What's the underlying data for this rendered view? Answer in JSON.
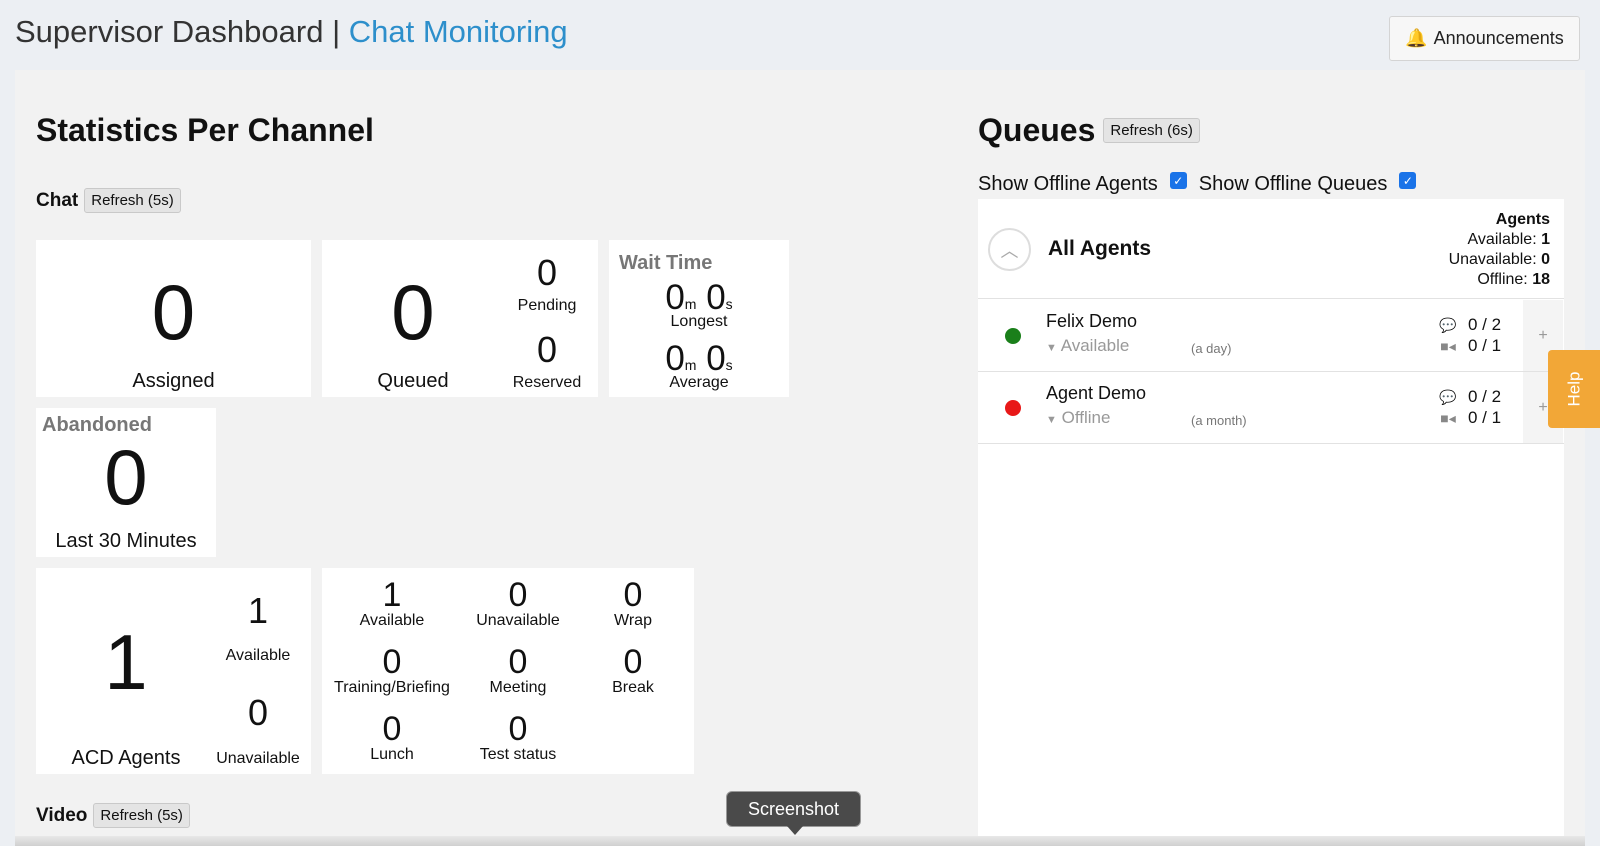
{
  "header": {
    "title": "Supervisor Dashboard",
    "separator": "|",
    "link": "Chat Monitoring",
    "announcements_label": "Announcements"
  },
  "stats": {
    "title": "Statistics Per Channel",
    "chat": {
      "label": "Chat",
      "refresh": "Refresh (5s)",
      "assigned": {
        "value": "0",
        "label": "Assigned"
      },
      "queued": {
        "value": "0",
        "label": "Queued",
        "pending_value": "0",
        "pending_label": "Pending",
        "reserved_value": "0",
        "reserved_label": "Reserved"
      },
      "wait_time": {
        "title": "Wait Time",
        "longest_m": "0",
        "longest_s": "0",
        "longest_label": "Longest",
        "average_m": "0",
        "average_s": "0",
        "average_label": "Average",
        "m_unit": "m",
        "s_unit": "s"
      },
      "abandoned": {
        "title": "Abandoned",
        "value": "0",
        "label": "Last 30 Minutes"
      },
      "acd": {
        "value": "1",
        "label": "ACD Agents",
        "available_value": "1",
        "available_label": "Available",
        "unavailable_value": "0",
        "unavailable_label": "Unavailable"
      },
      "states": [
        {
          "value": "1",
          "label": "Available"
        },
        {
          "value": "0",
          "label": "Unavailable"
        },
        {
          "value": "0",
          "label": "Wrap"
        },
        {
          "value": "0",
          "label": "Training/Briefing"
        },
        {
          "value": "0",
          "label": "Meeting"
        },
        {
          "value": "0",
          "label": "Break"
        },
        {
          "value": "0",
          "label": "Lunch"
        },
        {
          "value": "0",
          "label": "Test status"
        }
      ]
    },
    "video": {
      "label": "Video",
      "refresh": "Refresh (5s)"
    }
  },
  "queues": {
    "title": "Queues",
    "refresh": "Refresh (6s)",
    "show_offline_agents": "Show Offline Agents",
    "show_offline_queues": "Show Offline Queues",
    "all_agents": {
      "label": "All Agents",
      "agents_heading": "Agents",
      "available_label": "Available:",
      "available_value": "1",
      "unavailable_label": "Unavailable:",
      "unavailable_value": "0",
      "offline_label": "Offline:",
      "offline_value": "18"
    },
    "agents": [
      {
        "name": "Felix Demo",
        "status": "Available",
        "since": "(a day)",
        "chat": "0 / 2",
        "video": "0 / 1",
        "color": "#1a7f1a"
      },
      {
        "name": "Agent Demo",
        "status": "Offline",
        "since": "(a month)",
        "chat": "0 / 2",
        "video": "0 / 1",
        "color": "#e81818"
      }
    ]
  },
  "help_label": "Help",
  "tooltip": "Screenshot"
}
